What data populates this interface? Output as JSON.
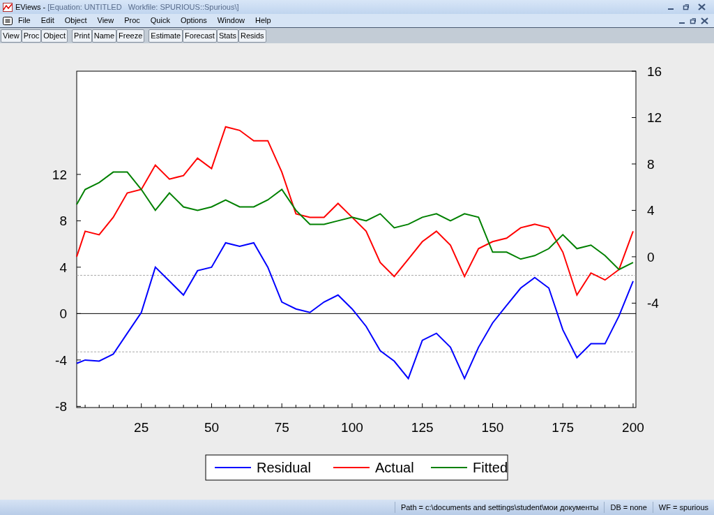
{
  "window": {
    "title_app": "EViews - ",
    "title_doc": "[Equation: UNTITLED   Workfile: SPURIOUS::Spurious\\]"
  },
  "menu": [
    "File",
    "Edit",
    "Object",
    "View",
    "Proc",
    "Quick",
    "Options",
    "Window",
    "Help"
  ],
  "toolbar": [
    [
      "View",
      "Proc",
      "Object"
    ],
    [
      "Print",
      "Name",
      "Freeze"
    ],
    [
      "Estimate",
      "Forecast",
      "Stats",
      "Resids"
    ]
  ],
  "chart": {
    "chart_data": {
      "type": "line",
      "x": [
        2,
        5,
        10,
        15,
        20,
        25,
        30,
        35,
        40,
        45,
        50,
        55,
        60,
        65,
        70,
        75,
        80,
        85,
        90,
        95,
        100,
        105,
        110,
        115,
        120,
        125,
        130,
        135,
        140,
        145,
        150,
        155,
        160,
        165,
        170,
        175,
        180,
        185,
        190,
        195,
        200
      ],
      "xlim": [
        2,
        201
      ],
      "xticks": [
        25,
        50,
        75,
        100,
        125,
        150,
        175,
        200
      ],
      "ylim": [
        -8.1,
        20.9
      ],
      "yticks": [
        -8,
        -4,
        0,
        4,
        8,
        12
      ],
      "y2lim": [
        -13,
        16
      ],
      "y2ticks": [
        -4,
        0,
        4,
        8,
        12,
        16
      ],
      "ref_lines": [
        {
          "axis": "y",
          "value": 3.3
        },
        {
          "axis": "y",
          "value": -3.3
        }
      ],
      "legend": "bottom",
      "series": [
        {
          "name": "Residual",
          "color": "#0000ff",
          "values": [
            -4.3,
            -4.0,
            -4.1,
            -3.5,
            -1.7,
            0.1,
            4.0,
            2.8,
            1.6,
            3.7,
            4.0,
            6.1,
            5.8,
            6.1,
            4.0,
            1.0,
            0.4,
            0.1,
            1.0,
            1.6,
            0.4,
            -1.1,
            -3.2,
            -4.1,
            -5.6,
            -2.3,
            -1.7,
            -2.9,
            -5.6,
            -2.9,
            -0.8,
            0.7,
            2.2,
            3.1,
            2.2,
            -1.4,
            -3.8,
            -2.6,
            -2.6,
            -0.2,
            2.8
          ]
        },
        {
          "name": "Actual",
          "color": "#ff0000",
          "axis": "y2",
          "values": [
            0.0,
            2.2,
            1.9,
            3.4,
            5.5,
            5.8,
            7.9,
            6.7,
            7.0,
            8.5,
            7.6,
            11.2,
            10.9,
            10.0,
            10.0,
            7.3,
            3.7,
            3.4,
            3.4,
            4.6,
            3.4,
            2.2,
            -0.5,
            -1.7,
            -0.2,
            1.3,
            2.2,
            1.0,
            -1.7,
            0.7,
            1.3,
            1.6,
            2.5,
            2.8,
            2.5,
            0.4,
            -3.3,
            -1.4,
            -2.0,
            -1.1,
            2.2
          ]
        },
        {
          "name": "Fitted",
          "color": "#008000",
          "axis": "y2",
          "values": [
            4.5,
            5.8,
            6.4,
            7.3,
            7.3,
            5.8,
            4.0,
            5.5,
            4.3,
            4.0,
            4.3,
            4.9,
            4.3,
            4.3,
            4.9,
            5.8,
            4.0,
            2.8,
            2.8,
            3.1,
            3.4,
            3.1,
            3.7,
            2.5,
            2.8,
            3.4,
            3.7,
            3.1,
            3.7,
            3.4,
            0.4,
            0.4,
            -0.2,
            0.1,
            0.7,
            1.9,
            0.7,
            1.0,
            0.1,
            -1.1,
            -0.5
          ]
        }
      ]
    }
  },
  "status_bar": [
    "Path = c:\\documents and settings\\student\\мои документы",
    "DB = none",
    "WF = spurious"
  ]
}
